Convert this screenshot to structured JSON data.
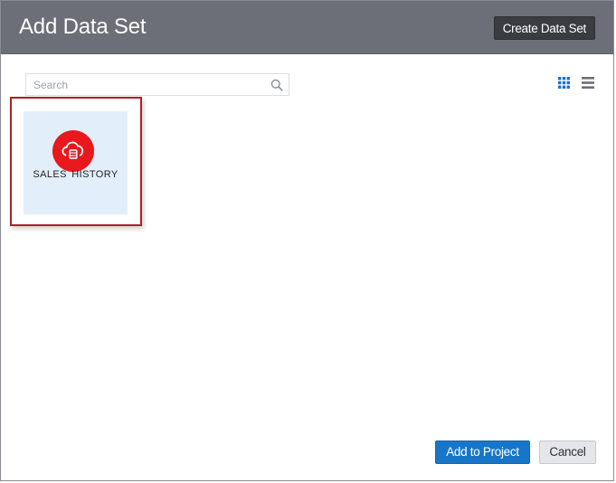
{
  "dialog": {
    "title": "Add Data Set",
    "create_button_label": "Create Data Set"
  },
  "search": {
    "placeholder": "Search",
    "value": ""
  },
  "view_toggle": {
    "grid_icon": "grid-view-icon",
    "list_icon": "list-view-icon",
    "active_color": "#1a72c4",
    "inactive_color": "#6c6f78"
  },
  "datasets": [
    {
      "label": "SALES  HISTORY",
      "icon": "cloud-database-icon",
      "icon_color": "#e8181c",
      "selected": true
    }
  ],
  "footer": {
    "add_button_label": "Add to Project",
    "cancel_button_label": "Cancel"
  },
  "colors": {
    "header_bg": "#6c6f78",
    "primary_button": "#1876c8",
    "selection_border": "#b01e23",
    "card_bg": "#e3eefb"
  }
}
